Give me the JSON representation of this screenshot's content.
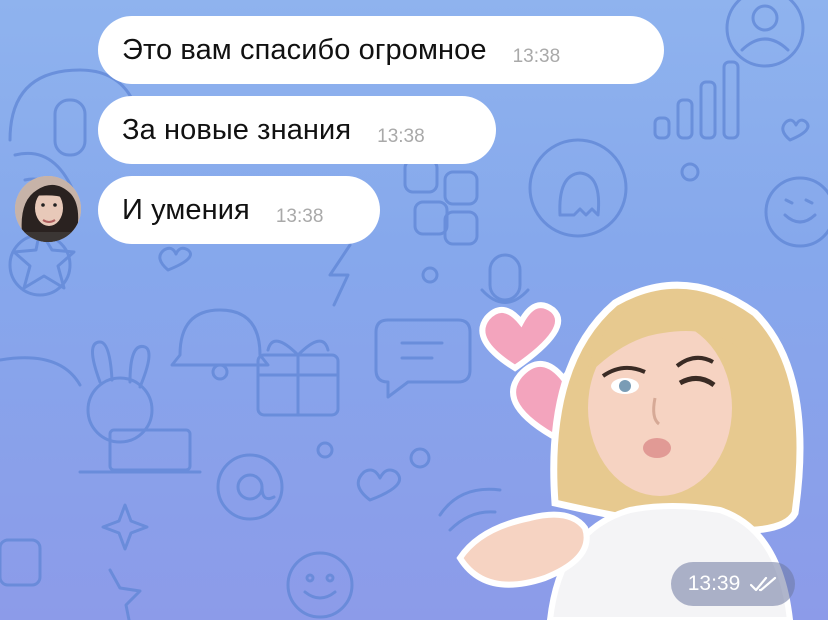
{
  "messages": [
    {
      "text": "Это вам спасибо огромное",
      "time": "13:38"
    },
    {
      "text": "За новые знания",
      "time": "13:38"
    },
    {
      "text": "И умения",
      "time": "13:38"
    }
  ],
  "sticker": {
    "time": "13:39",
    "status_icon": "double-check-icon"
  },
  "colors": {
    "bubble": "#ffffff",
    "wallpaper_top": "#8fb3ee",
    "wallpaper_bottom": "#8c9be9",
    "pattern": "#5f86d6"
  }
}
